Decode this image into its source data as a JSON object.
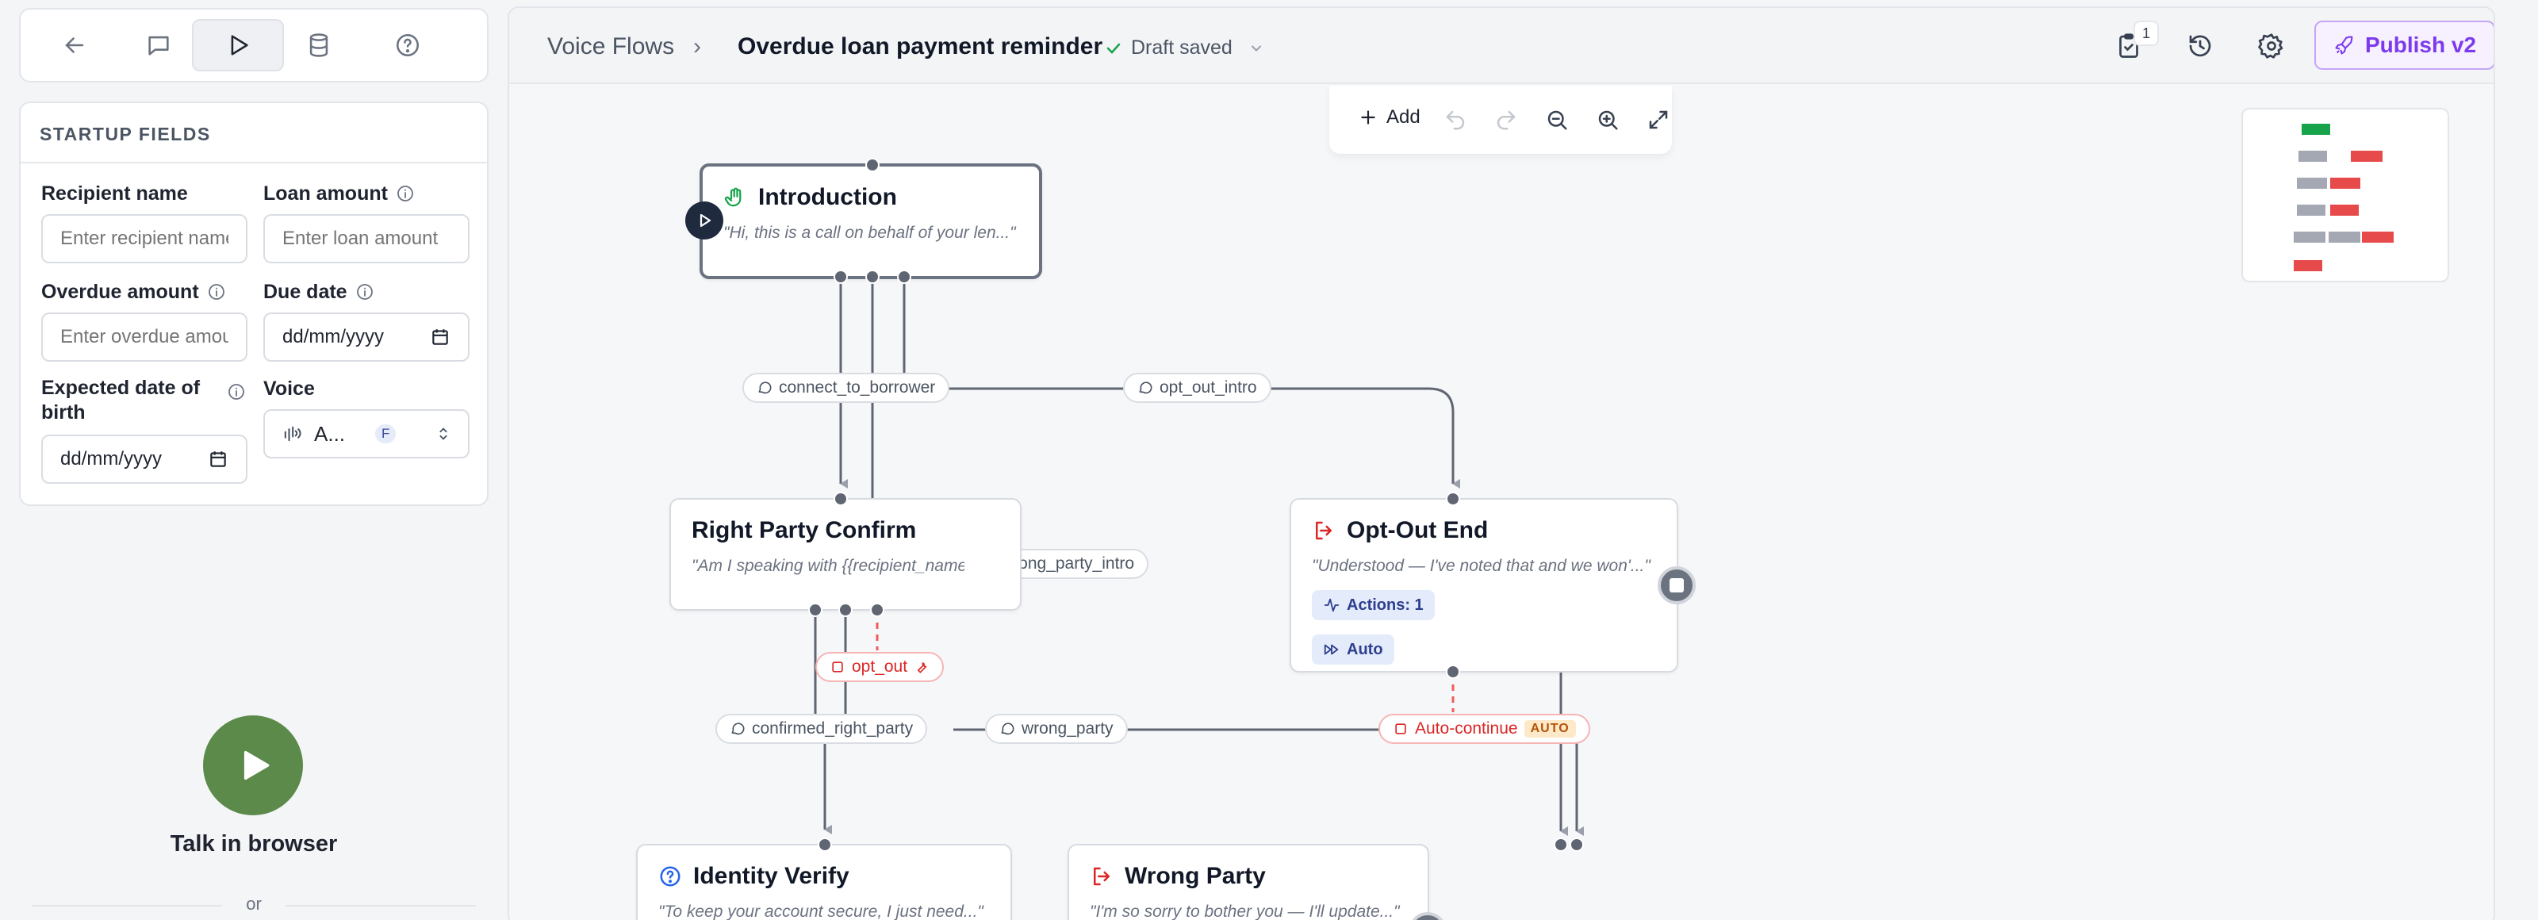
{
  "sidebar": {
    "section_title": "STARTUP FIELDS",
    "fields": {
      "recipient_name": {
        "label": "Recipient name",
        "placeholder": "Enter recipient name"
      },
      "loan_amount": {
        "label": "Loan amount",
        "placeholder": "Enter loan amount"
      },
      "overdue_amount": {
        "label": "Overdue amount",
        "placeholder": "Enter overdue amount"
      },
      "due_date": {
        "label": "Due date",
        "value": "dd/mm/yyyy"
      },
      "expected_dob": {
        "label_line1": "Expected date of",
        "label_line2": "birth",
        "value": "dd/mm/yyyy"
      },
      "voice": {
        "label": "Voice",
        "value": "A...",
        "tag": "F"
      }
    },
    "talk_label": "Talk in browser",
    "or_text": "or"
  },
  "header": {
    "breadcrumb_parent": "Voice Flows",
    "breadcrumb_sep": "›",
    "flow_title": "Overdue loan payment reminder",
    "draft_status": "Draft saved",
    "badge_count": "1",
    "publish_label": "Publish v2"
  },
  "toolbar": {
    "add_label": "Add"
  },
  "nodes": {
    "introduction": {
      "title": "Introduction",
      "subtitle": "\"Hi, this is a call on behalf of your len...\""
    },
    "right_party": {
      "title": "Right Party Confirm",
      "subtitle": "\"Am I speaking with {{recipient_name}}?\""
    },
    "opt_out_end": {
      "title": "Opt-Out End",
      "subtitle": "\"Understood — I've noted that and we won'...\"",
      "actions": "Actions: 1",
      "auto": "Auto"
    },
    "identity_verify": {
      "title": "Identity Verify",
      "subtitle": "\"To keep your account secure, I just need...\""
    },
    "wrong_party": {
      "title": "Wrong Party",
      "subtitle": "\"I'm so sorry to bother you — I'll update...\""
    }
  },
  "edges": {
    "connect_to_borrower": "connect_to_borrower",
    "opt_out_intro": "opt_out_intro",
    "wrong_party_intro": "wrong_party_intro",
    "opt_out": "opt_out",
    "confirmed_right_party": "confirmed_right_party",
    "wrong_party": "wrong_party",
    "auto_continue": "Auto-continue",
    "auto_tag": "AUTO"
  },
  "colors": {
    "accent": "#7c3aed",
    "success": "#16a34a",
    "danger": "#dc2626",
    "talk": "#5b8a4a"
  }
}
